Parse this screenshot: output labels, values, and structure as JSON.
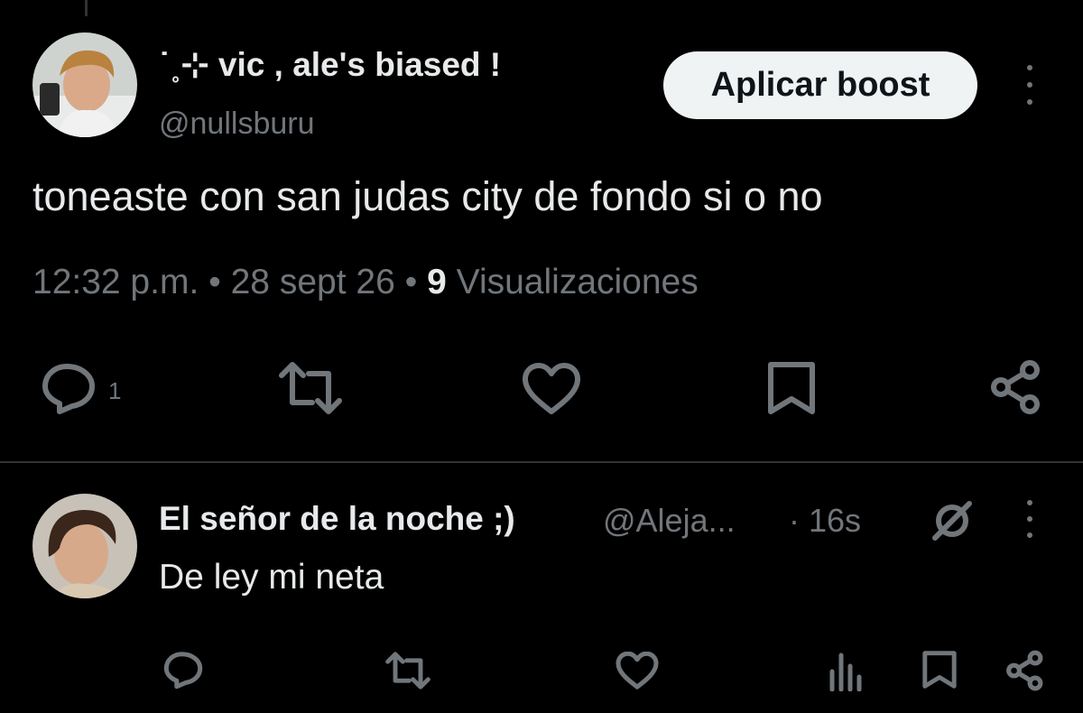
{
  "main_tweet": {
    "author_name": "˙˳⊹ vic , ale's biased !",
    "author_handle": "@nullsburu",
    "boost_label": "Aplicar boost",
    "text": "toneaste con san judas city de fondo si o no",
    "time": "12:32 p.m.",
    "separator": " • ",
    "date": "28 sept 26",
    "views_count": "9",
    "views_label": "Visualizaciones",
    "actions": {
      "reply_count": "1"
    }
  },
  "reply_tweet": {
    "author_name": "El señor de la noche ;)",
    "author_handle": "@Aleja...",
    "time": "· 16s",
    "text": "De ley mi neta"
  },
  "colors": {
    "background": "#000000",
    "text_primary": "#e7e9ea",
    "text_secondary": "#71767b",
    "divider": "#2f3336",
    "button_bg": "#eff3f4"
  },
  "icons": [
    "reply-icon",
    "retweet-icon",
    "like-icon",
    "bookmark-icon",
    "share-icon",
    "more-icon",
    "views-icon",
    "grok-icon"
  ]
}
